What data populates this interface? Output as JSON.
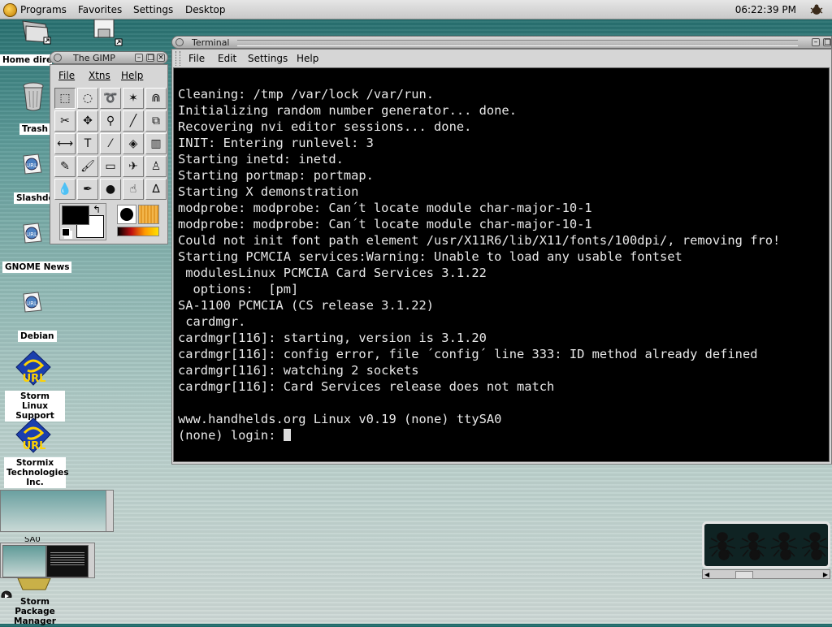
{
  "panel": {
    "menus": [
      "Programs",
      "Favorites",
      "Settings",
      "Desktop"
    ],
    "clock": "06:22:39 PM"
  },
  "desktop": {
    "icons": [
      {
        "label": "Home direct"
      },
      {
        "label": "Trash"
      },
      {
        "label": "Slashdo"
      },
      {
        "label": "GNOME News"
      },
      {
        "label": "Debian"
      },
      {
        "label": "Storm Linux Support"
      },
      {
        "label": "Stormix Technologies Inc."
      },
      {
        "label": "Storm Package Manager"
      }
    ],
    "url_badge": "URL",
    "pager_label": "SA0"
  },
  "gimp": {
    "title": "The GIMP",
    "menus": [
      "File",
      "Xtns",
      "Help"
    ],
    "tools": [
      "rect-select",
      "ellipse-select",
      "free-select",
      "fuzzy-select",
      "bezier-select",
      "iscissors",
      "move",
      "magnify",
      "crop",
      "transform",
      "flip",
      "text",
      "color-picker",
      "bucket-fill",
      "blend",
      "pencil",
      "paintbrush",
      "eraser",
      "airbrush",
      "clone",
      "convolve",
      "ink",
      "dodge-burn",
      "smudge",
      "measure"
    ],
    "tool_glyphs": [
      "⬚",
      "◌",
      "➰",
      "✶",
      "⋒",
      "✂",
      "✥",
      "⚲",
      "╱",
      "⧉",
      "⟷",
      "T",
      "⁄",
      "◈",
      "▥",
      "✎",
      "🖌",
      "▭",
      "✈",
      "♙",
      "💧",
      "✒",
      "●",
      "☝",
      "∆"
    ]
  },
  "terminal": {
    "title": "Terminal",
    "menus": [
      "File",
      "Edit",
      "Settings",
      "Help"
    ],
    "lines": [
      "Cleaning: /tmp /var/lock /var/run.",
      "Initializing random number generator... done.",
      "Recovering nvi editor sessions... done.",
      "INIT: Entering runlevel: 3",
      "Starting inetd: inetd.",
      "Starting portmap: portmap.",
      "Starting X demonstration",
      "modprobe: modprobe: Can´t locate module char-major-10-1",
      "modprobe: modprobe: Can´t locate module char-major-10-1",
      "Could not init font path element /usr/X11R6/lib/X11/fonts/100dpi/, removing fro!",
      "Starting PCMCIA services:Warning: Unable to load any usable fontset",
      " modulesLinux PCMCIA Card Services 3.1.22",
      "  options:  [pm]",
      "SA-1100 PCMCIA (CS release 3.1.22)",
      " cardmgr.",
      "cardmgr[116]: starting, version is 3.1.20",
      "cardmgr[116]: config error, file ´config´ line 333: ID method already defined",
      "cardmgr[116]: watching 2 sockets",
      "cardmgr[116]: Card Services release does not match",
      "",
      "www.handhelds.org Linux v0.19 (none) ttySA0",
      ""
    ],
    "prompt": "(none) login: "
  },
  "colors": {
    "terminal_bg": "#000000",
    "terminal_fg": "#e8e8e8",
    "panel_bg": "#d4d4d4",
    "desktop_top": "#1f6a6a",
    "desktop_bottom": "#ced9d6"
  }
}
